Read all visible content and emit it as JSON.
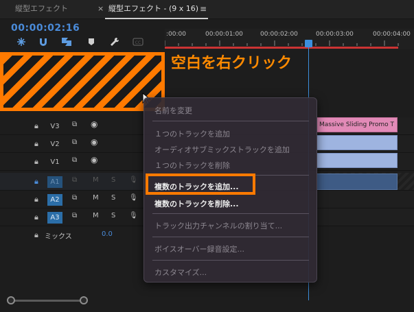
{
  "tabs": {
    "inactive_label": "縦型エフェクト",
    "close_glyph": "×",
    "active_label": "縦型エフェクト - (9 x 16)",
    "menu_glyph": "≡"
  },
  "timecode": "00:00:02:16",
  "ruler": {
    "labels": [
      ":00:00",
      "00:00:01:00",
      "00:00:02:00",
      "00:00:03:00",
      "00:00:04:00"
    ]
  },
  "callout": "空白を右クリック",
  "tracks": {
    "video": [
      {
        "name": "V3"
      },
      {
        "name": "V2"
      },
      {
        "name": "V1"
      }
    ],
    "audio": [
      {
        "name": "A1",
        "m": "M",
        "s": "S"
      },
      {
        "name": "A2",
        "m": "M",
        "s": "S"
      },
      {
        "name": "A3",
        "m": "M",
        "s": "S"
      }
    ],
    "mix_label": "ミックス",
    "mix_value": "0.0"
  },
  "clips": {
    "pink_title": "Massive Sliding Promo T"
  },
  "context_menu": {
    "rename": "名前を変更",
    "add_track": "１つのトラックを追加",
    "add_audio_submix": "オーディオサブミックストラックを追加",
    "delete_track": "１つのトラックを削除",
    "add_tracks": "複数のトラックを追加...",
    "delete_tracks": "複数のトラックを削除...",
    "assign_output": "トラック出力チャンネルの割り当て...",
    "voiceover": "ボイスオーバー録音設定...",
    "customize": "カスタマイズ..."
  },
  "colors": {
    "accent_orange": "#ff7a00",
    "timecode_blue": "#4a8bd9",
    "audio_track_blue": "#2b6ea8",
    "clip_pink": "#e28ab7",
    "clip_blue": "#9eb4e0",
    "work_area_red": "#cc3333"
  }
}
